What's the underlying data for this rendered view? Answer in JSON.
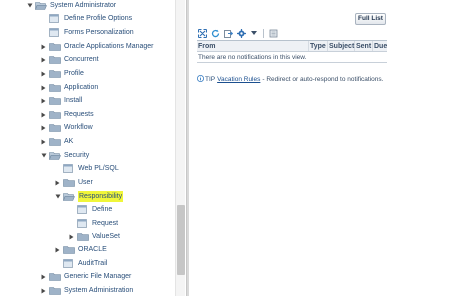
{
  "tree": {
    "nodes": [
      {
        "label": "System Administrator",
        "kind": "folder",
        "state": "expanded",
        "depth": 0
      },
      {
        "label": "Define Profile Options",
        "kind": "page",
        "state": "leaf",
        "depth": 1
      },
      {
        "label": "Forms Personalization",
        "kind": "page",
        "state": "leaf",
        "depth": 1
      },
      {
        "label": "Oracle Applications Manager",
        "kind": "folder",
        "state": "collapsed",
        "depth": 1
      },
      {
        "label": "Concurrent",
        "kind": "folder",
        "state": "collapsed",
        "depth": 1
      },
      {
        "label": "Profile",
        "kind": "folder",
        "state": "collapsed",
        "depth": 1
      },
      {
        "label": "Application",
        "kind": "folder",
        "state": "collapsed",
        "depth": 1
      },
      {
        "label": "Install",
        "kind": "folder",
        "state": "collapsed",
        "depth": 1
      },
      {
        "label": "Requests",
        "kind": "folder",
        "state": "collapsed",
        "depth": 1
      },
      {
        "label": "Workflow",
        "kind": "folder",
        "state": "collapsed",
        "depth": 1
      },
      {
        "label": "AK",
        "kind": "folder",
        "state": "collapsed",
        "depth": 1
      },
      {
        "label": "Security",
        "kind": "folder",
        "state": "expanded",
        "depth": 1
      },
      {
        "label": "Web PL/SQL",
        "kind": "page",
        "state": "leaf",
        "depth": 2
      },
      {
        "label": "User",
        "kind": "folder",
        "state": "collapsed",
        "depth": 2
      },
      {
        "label": "Responsibility",
        "kind": "folder",
        "state": "expanded",
        "depth": 2,
        "highlighted": true
      },
      {
        "label": "Define",
        "kind": "page",
        "state": "leaf",
        "depth": 3
      },
      {
        "label": "Request",
        "kind": "page",
        "state": "leaf",
        "depth": 3
      },
      {
        "label": "ValueSet",
        "kind": "folder",
        "state": "collapsed",
        "depth": 3
      },
      {
        "label": "ORACLE",
        "kind": "folder",
        "state": "collapsed",
        "depth": 2
      },
      {
        "label": "AuditTrail",
        "kind": "page",
        "state": "leaf",
        "depth": 2
      },
      {
        "label": "Generic File Manager",
        "kind": "folder",
        "state": "collapsed",
        "depth": 1
      },
      {
        "label": "System Administration",
        "kind": "folder",
        "state": "collapsed",
        "depth": 1
      }
    ]
  },
  "worklist": {
    "full_list_label": "Full List",
    "toolbar_icons": [
      "expand-icon",
      "refresh-icon",
      "export-icon",
      "settings-icon",
      "dropdown-icon",
      "detach-icon"
    ],
    "columns": [
      "From",
      "Type",
      "Subject",
      "Sent",
      "Due"
    ],
    "empty_message": "There are no notifications in this view.",
    "tip": {
      "label": "TIP",
      "link_text": "Vacation Rules",
      "text": "- Redirect or auto-respond to notifications."
    }
  },
  "colors": {
    "link": "#2a4f7a",
    "folder": "#9fb3c8",
    "highlight": "#f0f63a",
    "expand_arrow": "#4a4a4a"
  }
}
